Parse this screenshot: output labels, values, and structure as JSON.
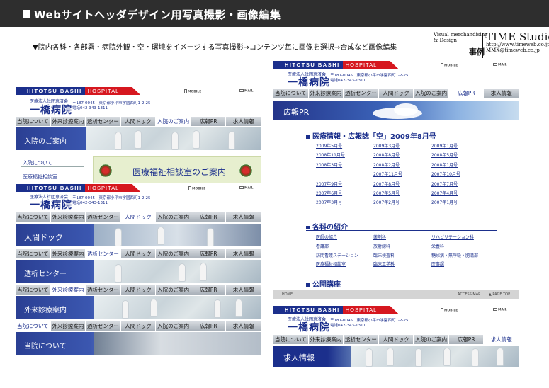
{
  "header": {
    "title": "Webサイトヘッダデザイン用写真撮影・画像編集"
  },
  "intro": "▼院内各科・各部署・病院外観・空・環境をイメージする写真撮影→コンテンツ毎に画像を選択→合成など画像編集",
  "brand": {
    "line1": "Visual merchandising",
    "line2": "& Design",
    "jirei": "事例",
    "name": "TIME Studio.",
    "url": "http://www.timeweb.co.jp/",
    "mail": "MMX@timeweb.co.jp"
  },
  "hospital": {
    "logo_a": "HITOTSU",
    "logo_b": "BASHI",
    "logo_c": "HOSPITAL",
    "corp": "医療法人社団恵済会",
    "name": "一橋病院",
    "addr1": "〒187-0045　東京都小平市学園西町1-2-25",
    "tel": "電話042-343-1311",
    "mobile": "MOBILE",
    "mail": "MAIL",
    "nav": [
      "当院について",
      "外来診療案内",
      "透析センター",
      "人間ドック",
      "入院のご案内",
      "広報PR",
      "求人情報"
    ]
  },
  "left_top": {
    "banner": "入院のご案内",
    "sub1": "入院について",
    "sub2": "医療福祉相談室",
    "social": "医療福祉相談室のご案内"
  },
  "left_banners": [
    "人間ドック",
    "透析センター",
    "外来診療案内",
    "当院について"
  ],
  "right": {
    "pr_title": "広報PR",
    "sec1": "医療情報・広報誌「空」2009年8月号",
    "issues": [
      [
        "2009年5月号",
        "2009年3月号",
        "2009年1月号"
      ],
      [
        "2008年11月号",
        "2008年8月号",
        "2008年5月号"
      ],
      [
        "2008年3月号",
        "2008年2月号",
        "2008年1月号"
      ],
      [
        "",
        "2007年11月号",
        "2007年10月号"
      ],
      [
        "2007年9月号",
        "2007年8月号",
        "2007年7月号"
      ],
      [
        "2007年6月号",
        "2007年5月号",
        "2007年4月号"
      ],
      [
        "2007年3月号",
        "2007年2月号",
        "2007年1月号"
      ]
    ],
    "sec2": "各科の紹介",
    "depts": [
      [
        "医師の紹介",
        "薬剤科",
        "リハビリテーション科"
      ],
      [
        "看護部",
        "放射線科",
        "栄養科"
      ],
      [
        "訪問看護ステーション",
        "臨床検査科",
        "糖尿病・無呼吸・肥満部"
      ],
      [
        "医療福祉相談室",
        "臨床工学科",
        "医事課"
      ]
    ],
    "sec3": "公開講座",
    "foot_home": "HOME",
    "foot_access": "ACCESS MAP",
    "foot_top": "▲ PAGE TOP",
    "kyujin": "求人情報"
  }
}
